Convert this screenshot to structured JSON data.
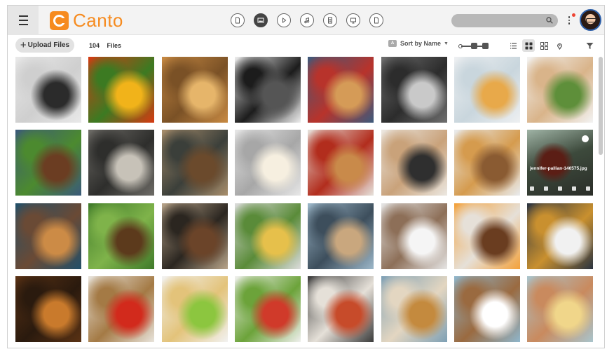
{
  "app": {
    "name": "Canto"
  },
  "header": {
    "type_filters": [
      {
        "name": "all-files",
        "icon": "document-icon",
        "active": false
      },
      {
        "name": "images",
        "icon": "image-icon",
        "active": true
      },
      {
        "name": "videos",
        "icon": "play-icon",
        "active": false
      },
      {
        "name": "audio",
        "icon": "music-icon",
        "active": false
      },
      {
        "name": "documents",
        "icon": "text-document-icon",
        "active": false
      },
      {
        "name": "presentations",
        "icon": "presentation-icon",
        "active": false
      },
      {
        "name": "others",
        "icon": "file-icon",
        "active": false
      }
    ],
    "search": {
      "placeholder": "",
      "value": ""
    }
  },
  "toolbar": {
    "upload_label": "Upload Files",
    "file_count": "104",
    "file_count_label": "Files",
    "sort_label": "Sort by Name"
  },
  "grid": {
    "hovered_file": "jennifer-pallian-146575.jpg",
    "tiles": [
      {
        "subject": "chefs",
        "colors": [
          "#e9e9e9",
          "#2b2b2b",
          "#cfcfcf"
        ]
      },
      {
        "subject": "peppers",
        "colors": [
          "#d63a12",
          "#f1b31a",
          "#3c7a22"
        ]
      },
      {
        "subject": "pastries",
        "colors": [
          "#c88a43",
          "#e6b56a",
          "#7a5126"
        ]
      },
      {
        "subject": "meat-bw",
        "colors": [
          "#eeeeee",
          "#555555",
          "#1c1c1c"
        ]
      },
      {
        "subject": "pancakes",
        "colors": [
          "#3d5a7c",
          "#d59b57",
          "#b8332b"
        ]
      },
      {
        "subject": "pan",
        "colors": [
          "#6f6f6f",
          "#c9c9c9",
          "#2c2c2c"
        ]
      },
      {
        "subject": "lemonade",
        "colors": [
          "#eef0f2",
          "#e8a94a",
          "#c9d6dd"
        ]
      },
      {
        "subject": "salad-plate",
        "colors": [
          "#f3f3f3",
          "#5e8f3a",
          "#d9b48a"
        ]
      },
      {
        "subject": "steak",
        "colors": [
          "#3b5a7a",
          "#6b3d22",
          "#4c8a2f"
        ]
      },
      {
        "subject": "kitchen",
        "colors": [
          "#6d6b66",
          "#c7c2b8",
          "#2e2e2c"
        ]
      },
      {
        "subject": "bread",
        "colors": [
          "#a88e6c",
          "#6b4a2c",
          "#3b3f3a"
        ]
      },
      {
        "subject": "risotto",
        "colors": [
          "#e7e7e7",
          "#f6efe0",
          "#a7a7a7"
        ]
      },
      {
        "subject": "sandwich",
        "colors": [
          "#e6e2dc",
          "#c98a4a",
          "#b22d1d"
        ]
      },
      {
        "subject": "tray-bake",
        "colors": [
          "#ece8e2",
          "#2f2f2f",
          "#c9a27a"
        ]
      },
      {
        "subject": "jars",
        "colors": [
          "#e9ecef",
          "#8a5b32",
          "#d59b4e"
        ]
      },
      {
        "subject": "bowl-dark",
        "colors": [
          "#3e4a3a",
          "#7b2e22",
          "#9bb0a0"
        ]
      },
      {
        "subject": "cookies",
        "colors": [
          "#22506a",
          "#cc8b46",
          "#6a4a35"
        ]
      },
      {
        "subject": "soup-bowl",
        "colors": [
          "#3f7a2a",
          "#5c3a1c",
          "#7fb34a"
        ]
      },
      {
        "subject": "spices",
        "colors": [
          "#b8a48a",
          "#6b4429",
          "#2b2620"
        ]
      },
      {
        "subject": "quiche",
        "colors": [
          "#dcdcdc",
          "#e6c04b",
          "#5a8b39"
        ]
      },
      {
        "subject": "ice-cream",
        "colors": [
          "#9cb7c9",
          "#c9a77e",
          "#3d4e5c"
        ]
      },
      {
        "subject": "noodle-bowl",
        "colors": [
          "#e6e6e6",
          "#f5f5f5",
          "#8d6f58"
        ]
      },
      {
        "subject": "juice",
        "colors": [
          "#f3a13a",
          "#6a3d20",
          "#e6e0d8"
        ]
      },
      {
        "subject": "pie",
        "colors": [
          "#2a3340",
          "#f1f1f1",
          "#c9902f"
        ]
      },
      {
        "subject": "cookie-tray",
        "colors": [
          "#5a3214",
          "#c97a2c",
          "#2a1a0e"
        ]
      },
      {
        "subject": "tomatoes",
        "colors": [
          "#e8e4dc",
          "#d22a1c",
          "#a47a45"
        ]
      },
      {
        "subject": "cereal",
        "colors": [
          "#f2f2f2",
          "#8cc63f",
          "#e3c37a"
        ]
      },
      {
        "subject": "salad-mix",
        "colors": [
          "#f0f0ee",
          "#d03a2a",
          "#6ca33a"
        ]
      },
      {
        "subject": "grill",
        "colors": [
          "#3a3a3a",
          "#c74b2a",
          "#e5e0d8"
        ]
      },
      {
        "subject": "burgers",
        "colors": [
          "#7ea0b5",
          "#c48a3e",
          "#e3d6c1"
        ]
      },
      {
        "subject": "latte",
        "colors": [
          "#8fb6cc",
          "#ffffff",
          "#9a6a40"
        ]
      },
      {
        "subject": "fries",
        "colors": [
          "#a9c4cc",
          "#f0d68a",
          "#c98a5e"
        ]
      }
    ]
  }
}
